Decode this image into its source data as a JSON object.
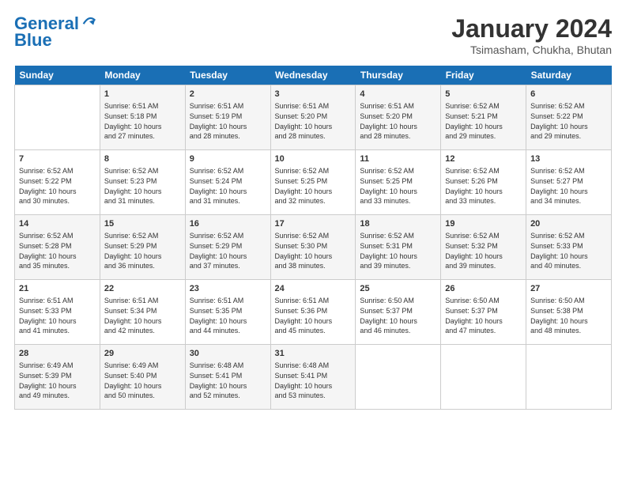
{
  "header": {
    "logo_line1": "General",
    "logo_line2": "Blue",
    "month_title": "January 2024",
    "location": "Tsimasham, Chukha, Bhutan"
  },
  "days_of_week": [
    "Sunday",
    "Monday",
    "Tuesday",
    "Wednesday",
    "Thursday",
    "Friday",
    "Saturday"
  ],
  "weeks": [
    [
      {
        "day": "",
        "content": ""
      },
      {
        "day": "1",
        "content": "Sunrise: 6:51 AM\nSunset: 5:18 PM\nDaylight: 10 hours\nand 27 minutes."
      },
      {
        "day": "2",
        "content": "Sunrise: 6:51 AM\nSunset: 5:19 PM\nDaylight: 10 hours\nand 28 minutes."
      },
      {
        "day": "3",
        "content": "Sunrise: 6:51 AM\nSunset: 5:20 PM\nDaylight: 10 hours\nand 28 minutes."
      },
      {
        "day": "4",
        "content": "Sunrise: 6:51 AM\nSunset: 5:20 PM\nDaylight: 10 hours\nand 28 minutes."
      },
      {
        "day": "5",
        "content": "Sunrise: 6:52 AM\nSunset: 5:21 PM\nDaylight: 10 hours\nand 29 minutes."
      },
      {
        "day": "6",
        "content": "Sunrise: 6:52 AM\nSunset: 5:22 PM\nDaylight: 10 hours\nand 29 minutes."
      }
    ],
    [
      {
        "day": "7",
        "content": "Sunrise: 6:52 AM\nSunset: 5:22 PM\nDaylight: 10 hours\nand 30 minutes."
      },
      {
        "day": "8",
        "content": "Sunrise: 6:52 AM\nSunset: 5:23 PM\nDaylight: 10 hours\nand 31 minutes."
      },
      {
        "day": "9",
        "content": "Sunrise: 6:52 AM\nSunset: 5:24 PM\nDaylight: 10 hours\nand 31 minutes."
      },
      {
        "day": "10",
        "content": "Sunrise: 6:52 AM\nSunset: 5:25 PM\nDaylight: 10 hours\nand 32 minutes."
      },
      {
        "day": "11",
        "content": "Sunrise: 6:52 AM\nSunset: 5:25 PM\nDaylight: 10 hours\nand 33 minutes."
      },
      {
        "day": "12",
        "content": "Sunrise: 6:52 AM\nSunset: 5:26 PM\nDaylight: 10 hours\nand 33 minutes."
      },
      {
        "day": "13",
        "content": "Sunrise: 6:52 AM\nSunset: 5:27 PM\nDaylight: 10 hours\nand 34 minutes."
      }
    ],
    [
      {
        "day": "14",
        "content": "Sunrise: 6:52 AM\nSunset: 5:28 PM\nDaylight: 10 hours\nand 35 minutes."
      },
      {
        "day": "15",
        "content": "Sunrise: 6:52 AM\nSunset: 5:29 PM\nDaylight: 10 hours\nand 36 minutes."
      },
      {
        "day": "16",
        "content": "Sunrise: 6:52 AM\nSunset: 5:29 PM\nDaylight: 10 hours\nand 37 minutes."
      },
      {
        "day": "17",
        "content": "Sunrise: 6:52 AM\nSunset: 5:30 PM\nDaylight: 10 hours\nand 38 minutes."
      },
      {
        "day": "18",
        "content": "Sunrise: 6:52 AM\nSunset: 5:31 PM\nDaylight: 10 hours\nand 39 minutes."
      },
      {
        "day": "19",
        "content": "Sunrise: 6:52 AM\nSunset: 5:32 PM\nDaylight: 10 hours\nand 39 minutes."
      },
      {
        "day": "20",
        "content": "Sunrise: 6:52 AM\nSunset: 5:33 PM\nDaylight: 10 hours\nand 40 minutes."
      }
    ],
    [
      {
        "day": "21",
        "content": "Sunrise: 6:51 AM\nSunset: 5:33 PM\nDaylight: 10 hours\nand 41 minutes."
      },
      {
        "day": "22",
        "content": "Sunrise: 6:51 AM\nSunset: 5:34 PM\nDaylight: 10 hours\nand 42 minutes."
      },
      {
        "day": "23",
        "content": "Sunrise: 6:51 AM\nSunset: 5:35 PM\nDaylight: 10 hours\nand 44 minutes."
      },
      {
        "day": "24",
        "content": "Sunrise: 6:51 AM\nSunset: 5:36 PM\nDaylight: 10 hours\nand 45 minutes."
      },
      {
        "day": "25",
        "content": "Sunrise: 6:50 AM\nSunset: 5:37 PM\nDaylight: 10 hours\nand 46 minutes."
      },
      {
        "day": "26",
        "content": "Sunrise: 6:50 AM\nSunset: 5:37 PM\nDaylight: 10 hours\nand 47 minutes."
      },
      {
        "day": "27",
        "content": "Sunrise: 6:50 AM\nSunset: 5:38 PM\nDaylight: 10 hours\nand 48 minutes."
      }
    ],
    [
      {
        "day": "28",
        "content": "Sunrise: 6:49 AM\nSunset: 5:39 PM\nDaylight: 10 hours\nand 49 minutes."
      },
      {
        "day": "29",
        "content": "Sunrise: 6:49 AM\nSunset: 5:40 PM\nDaylight: 10 hours\nand 50 minutes."
      },
      {
        "day": "30",
        "content": "Sunrise: 6:48 AM\nSunset: 5:41 PM\nDaylight: 10 hours\nand 52 minutes."
      },
      {
        "day": "31",
        "content": "Sunrise: 6:48 AM\nSunset: 5:41 PM\nDaylight: 10 hours\nand 53 minutes."
      },
      {
        "day": "",
        "content": ""
      },
      {
        "day": "",
        "content": ""
      },
      {
        "day": "",
        "content": ""
      }
    ]
  ]
}
